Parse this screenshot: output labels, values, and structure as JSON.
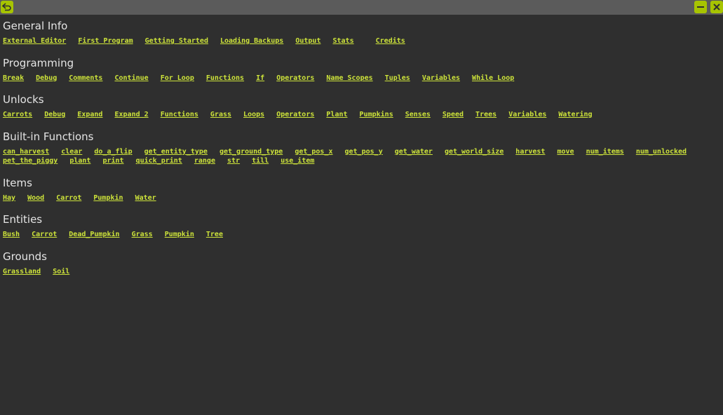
{
  "window": {
    "back_icon": "back-arrow-icon",
    "minimize_icon": "minimize-icon",
    "close_icon": "close-icon",
    "accent_color": "#a7c400",
    "link_color": "#cde33a"
  },
  "sections": [
    {
      "title": "General Info",
      "links": [
        "External Editor",
        "First Program",
        "Getting Started",
        "Loading Backups",
        "Output",
        "Stats",
        "Credits"
      ]
    },
    {
      "title": "Programming",
      "links": [
        "Break",
        "Debug",
        "Comments",
        "Continue",
        "For Loop",
        "Functions",
        "If",
        "Operators",
        "Name Scopes",
        "Tuples",
        "Variables",
        "While Loop"
      ]
    },
    {
      "title": "Unlocks",
      "links": [
        "Carrots",
        "Debug",
        "Expand",
        "Expand 2",
        "Functions",
        "Grass",
        "Loops",
        "Operators",
        "Plant",
        "Pumpkins",
        "Senses",
        "Speed",
        "Trees",
        "Variables",
        "Watering"
      ]
    },
    {
      "title": "Built-in Functions",
      "links": [
        "can_harvest",
        "clear",
        "do_a_flip",
        "get_entity_type",
        "get_ground_type",
        "get_pos_x",
        "get_pos_y",
        "get_water",
        "get_world_size",
        "harvest",
        "move",
        "num_items",
        "num_unlocked",
        "pet_the_piggy",
        "plant",
        "print",
        "quick_print",
        "range",
        "str",
        "till",
        "use_item"
      ]
    },
    {
      "title": "Items",
      "links": [
        "Hay",
        "Wood",
        "Carrot",
        "Pumpkin",
        "Water"
      ]
    },
    {
      "title": "Entities",
      "links": [
        "Bush",
        "Carrot",
        "Dead_Pumpkin",
        "Grass",
        "Pumpkin",
        "Tree"
      ]
    },
    {
      "title": "Grounds",
      "links": [
        "Grassland",
        "Soil"
      ]
    }
  ]
}
